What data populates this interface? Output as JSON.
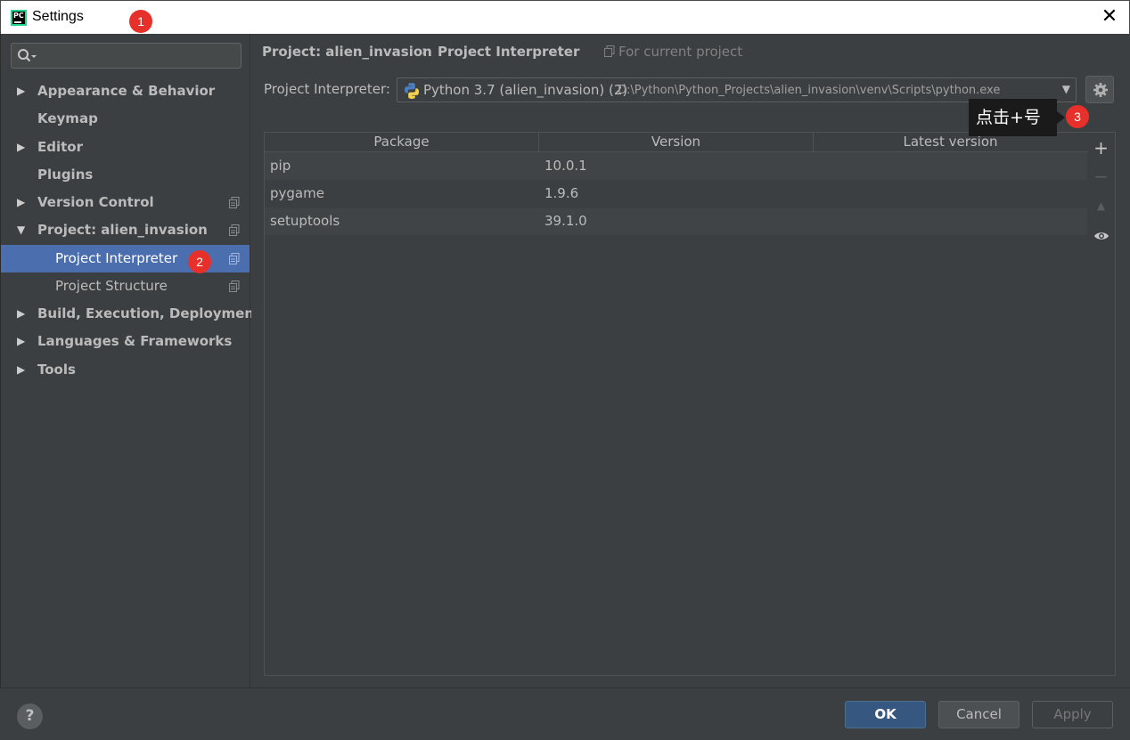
{
  "window": {
    "title": "Settings",
    "close_glyph": "✕",
    "app_icon_text": "PC"
  },
  "annotations": {
    "badge1": "1",
    "badge2": "2",
    "badge3": "3",
    "tooltip": "点击+号",
    "badge_color": "#e8302a"
  },
  "sidebar": {
    "search_placeholder": "",
    "items": [
      {
        "label": "Appearance & Behavior",
        "arrow": "▶"
      },
      {
        "label": "Keymap",
        "arrow": ""
      },
      {
        "label": "Editor",
        "arrow": "▶"
      },
      {
        "label": "Plugins",
        "arrow": ""
      },
      {
        "label": "Version Control",
        "arrow": "▶"
      },
      {
        "label": "Project: alien_invasion",
        "arrow": "▼"
      },
      {
        "label": "Project Interpreter",
        "arrow": ""
      },
      {
        "label": "Project Structure",
        "arrow": ""
      },
      {
        "label": "Build, Execution, Deployment",
        "arrow": "▶"
      },
      {
        "label": "Languages & Frameworks",
        "arrow": "▶"
      },
      {
        "label": "Tools",
        "arrow": "▶"
      }
    ]
  },
  "breadcrumb": {
    "project": "Project: alien_invasion",
    "separator": "›",
    "page": "Project Interpreter",
    "scope": "For current project"
  },
  "interpreter": {
    "label": "Project Interpreter:",
    "name": "Python 3.7 (alien_invasion) (2)",
    "path": "D:\\Python\\Python_Projects\\alien_invasion\\venv\\Scripts\\python.exe",
    "dropdown_arrow": "▼"
  },
  "packages": {
    "columns": [
      "Package",
      "Version",
      "Latest version"
    ],
    "rows": [
      {
        "package": "pip",
        "version": "10.0.1",
        "latest": ""
      },
      {
        "package": "pygame",
        "version": "1.9.6",
        "latest": ""
      },
      {
        "package": "setuptools",
        "version": "39.1.0",
        "latest": ""
      }
    ]
  },
  "toolbar": {
    "add": "+",
    "remove": "−",
    "upgrade": "▲"
  },
  "footer": {
    "help": "?",
    "ok": "OK",
    "cancel": "Cancel",
    "apply": "Apply"
  },
  "colors": {
    "accent_selected": "#4b6eaf",
    "ok_button": "#365880",
    "background": "#3c3f41"
  }
}
